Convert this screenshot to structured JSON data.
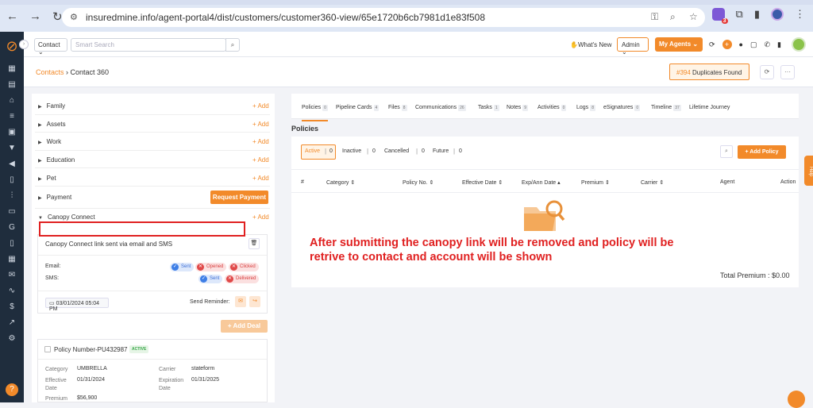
{
  "browser": {
    "url": "insuredmine.info/agent-portal4/dist/customers/customer360-view/65e1720b6cb7981d1e83f508"
  },
  "topbar": {
    "contact_type": "Contact",
    "search_placeholder": "Smart Search",
    "whats_new": "What's New",
    "admin": "Admin",
    "my_agents": "My Agents"
  },
  "breadcrumb": {
    "root": "Contacts",
    "current": "Contact 360"
  },
  "duplicates": {
    "count": "#394",
    "label": "Duplicates Found"
  },
  "sections": [
    {
      "label": "Family",
      "add": "+ Add"
    },
    {
      "label": "Assets",
      "add": "+ Add"
    },
    {
      "label": "Work",
      "add": "+ Add"
    },
    {
      "label": "Education",
      "add": "+ Add"
    },
    {
      "label": "Pet",
      "add": "+ Add"
    },
    {
      "label": "Payment",
      "action": "Request Payment"
    },
    {
      "label": "Canopy Connect",
      "add": "+ Add"
    }
  ],
  "canopy": {
    "title": "Canopy Connect link sent via email and SMS",
    "email_label": "Email:",
    "sms_label": "SMS:",
    "email_status": [
      "Sent",
      "Opened",
      "Clicked"
    ],
    "sms_status": [
      "Sent",
      "Delivered"
    ],
    "date": "03/01/2024 05:04 PM",
    "send_reminder": "Send Reminder:"
  },
  "add_deal": "+ Add Deal",
  "policy_card": {
    "number": "Policy Number-PU432987",
    "status": "ACTIVE",
    "category_label": "Category",
    "category": "UMBRELLA",
    "carrier_label": "Carrier",
    "carrier": "stateform",
    "effective_label": "Effective Date",
    "effective": "01/31/2024",
    "expiration_label": "Expiration Date",
    "expiration": "01/31/2025",
    "premium_label": "Premium",
    "premium": "$56,900"
  },
  "tabs": [
    {
      "label": "Policies",
      "count": "0"
    },
    {
      "label": "Pipeline Cards",
      "count": "4"
    },
    {
      "label": "Files",
      "count": "8"
    },
    {
      "label": "Communications",
      "count": "26"
    },
    {
      "label": "Tasks",
      "count": "1"
    },
    {
      "label": "Notes",
      "count": "9"
    },
    {
      "label": "Activities",
      "count": "0"
    },
    {
      "label": "Logs",
      "count": "8"
    },
    {
      "label": "eSignatures",
      "count": "0"
    },
    {
      "label": "Timeline",
      "count": "37"
    },
    {
      "label": "Lifetime Journey",
      "count": ""
    }
  ],
  "policies_heading": "Policies",
  "filters": [
    {
      "label": "Active",
      "count": "0"
    },
    {
      "label": "Inactive",
      "count": "0"
    },
    {
      "label": "Cancelled",
      "count": "0"
    },
    {
      "label": "Future",
      "count": "0"
    }
  ],
  "add_policy": "+ Add Policy",
  "columns": [
    "#",
    "Category ⇕",
    "Policy No. ⇕",
    "Effective Date ⇕",
    "Exp/Ann Date ▴",
    "Premium ⇕",
    "Carrier ⇕",
    "Agent",
    "Action"
  ],
  "annotation": "After submitting the canopy link will be removed and policy will be retrive to contact and account will be shown",
  "total_premium": "Total Premium : $0.00",
  "help": "Help",
  "colors": {
    "accent": "#f28a2a",
    "sidebar": "#1f2d3d",
    "annotation": "#e02020"
  }
}
